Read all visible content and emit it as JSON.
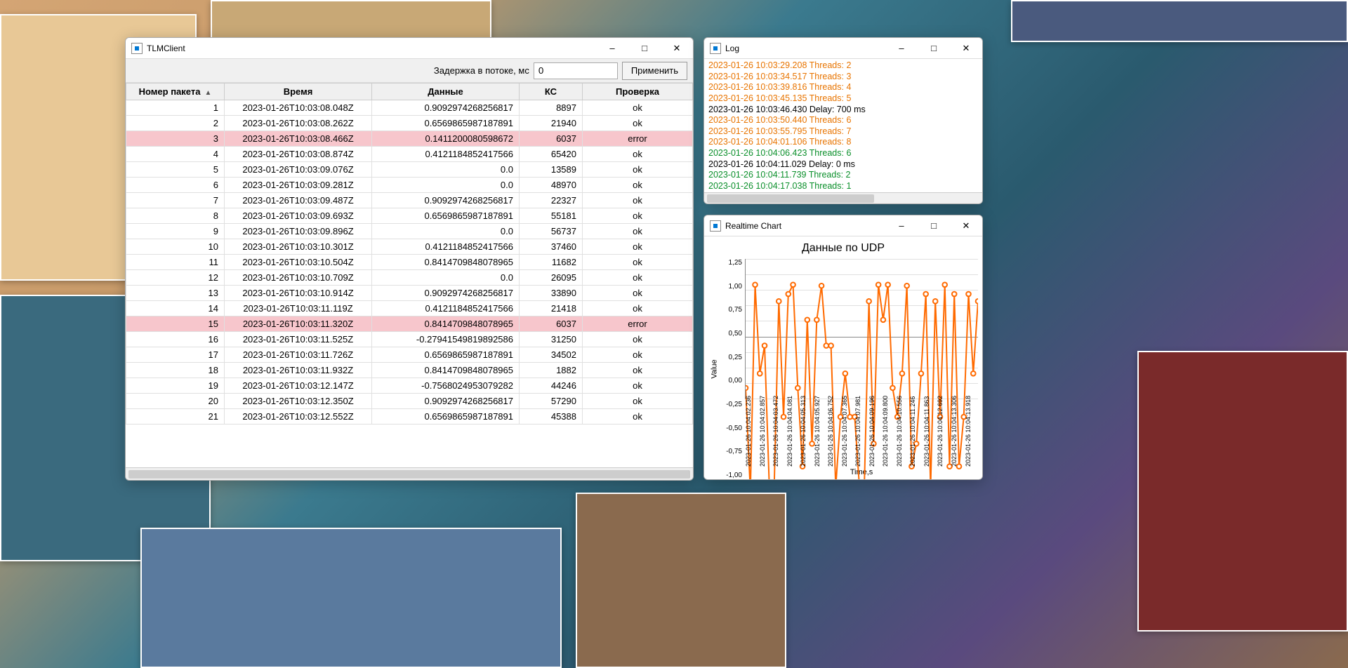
{
  "main_window": {
    "title": "TLMClient",
    "delay_label": "Задержка в потоке, мс",
    "delay_value": "0",
    "apply_label": "Применить",
    "columns": {
      "packet_no": "Номер пакета",
      "time": "Время",
      "data": "Данные",
      "ks": "КС",
      "check": "Проверка"
    },
    "rows": [
      {
        "n": "1",
        "time": "2023-01-26T10:03:08.048Z",
        "data": "0.9092974268256817",
        "ks": "8897",
        "check": "ok",
        "err": false
      },
      {
        "n": "2",
        "time": "2023-01-26T10:03:08.262Z",
        "data": "0.6569865987187891",
        "ks": "21940",
        "check": "ok",
        "err": false
      },
      {
        "n": "3",
        "time": "2023-01-26T10:03:08.466Z",
        "data": "0.1411200080598672",
        "ks": "6037",
        "check": "error",
        "err": true
      },
      {
        "n": "4",
        "time": "2023-01-26T10:03:08.874Z",
        "data": "0.4121184852417566",
        "ks": "65420",
        "check": "ok",
        "err": false
      },
      {
        "n": "5",
        "time": "2023-01-26T10:03:09.076Z",
        "data": "0.0",
        "ks": "13589",
        "check": "ok",
        "err": false
      },
      {
        "n": "6",
        "time": "2023-01-26T10:03:09.281Z",
        "data": "0.0",
        "ks": "48970",
        "check": "ok",
        "err": false
      },
      {
        "n": "7",
        "time": "2023-01-26T10:03:09.487Z",
        "data": "0.9092974268256817",
        "ks": "22327",
        "check": "ok",
        "err": false
      },
      {
        "n": "8",
        "time": "2023-01-26T10:03:09.693Z",
        "data": "0.6569865987187891",
        "ks": "55181",
        "check": "ok",
        "err": false
      },
      {
        "n": "9",
        "time": "2023-01-26T10:03:09.896Z",
        "data": "0.0",
        "ks": "56737",
        "check": "ok",
        "err": false
      },
      {
        "n": "10",
        "time": "2023-01-26T10:03:10.301Z",
        "data": "0.4121184852417566",
        "ks": "37460",
        "check": "ok",
        "err": false
      },
      {
        "n": "11",
        "time": "2023-01-26T10:03:10.504Z",
        "data": "0.8414709848078965",
        "ks": "11682",
        "check": "ok",
        "err": false
      },
      {
        "n": "12",
        "time": "2023-01-26T10:03:10.709Z",
        "data": "0.0",
        "ks": "26095",
        "check": "ok",
        "err": false
      },
      {
        "n": "13",
        "time": "2023-01-26T10:03:10.914Z",
        "data": "0.9092974268256817",
        "ks": "33890",
        "check": "ok",
        "err": false
      },
      {
        "n": "14",
        "time": "2023-01-26T10:03:11.119Z",
        "data": "0.4121184852417566",
        "ks": "21418",
        "check": "ok",
        "err": false
      },
      {
        "n": "15",
        "time": "2023-01-26T10:03:11.320Z",
        "data": "0.8414709848078965",
        "ks": "6037",
        "check": "error",
        "err": true
      },
      {
        "n": "16",
        "time": "2023-01-26T10:03:11.525Z",
        "data": "-0.27941549819892586",
        "ks": "31250",
        "check": "ok",
        "err": false
      },
      {
        "n": "17",
        "time": "2023-01-26T10:03:11.726Z",
        "data": "0.6569865987187891",
        "ks": "34502",
        "check": "ok",
        "err": false
      },
      {
        "n": "18",
        "time": "2023-01-26T10:03:11.932Z",
        "data": "0.8414709848078965",
        "ks": "1882",
        "check": "ok",
        "err": false
      },
      {
        "n": "19",
        "time": "2023-01-26T10:03:12.147Z",
        "data": "-0.7568024953079282",
        "ks": "44246",
        "check": "ok",
        "err": false
      },
      {
        "n": "20",
        "time": "2023-01-26T10:03:12.350Z",
        "data": "0.9092974268256817",
        "ks": "57290",
        "check": "ok",
        "err": false
      },
      {
        "n": "21",
        "time": "2023-01-26T10:03:12.552Z",
        "data": "0.6569865987187891",
        "ks": "45388",
        "check": "ok",
        "err": false
      }
    ]
  },
  "log_window": {
    "title": "Log",
    "lines": [
      {
        "text": "2023-01-26 10:03:29.208  Threads: 2",
        "cls": "orange"
      },
      {
        "text": "2023-01-26 10:03:34.517  Threads: 3",
        "cls": "orange"
      },
      {
        "text": "2023-01-26 10:03:39.816  Threads: 4",
        "cls": "orange"
      },
      {
        "text": "2023-01-26 10:03:45.135  Threads: 5",
        "cls": "orange"
      },
      {
        "text": "2023-01-26 10:03:46.430  Delay: 700 ms",
        "cls": "black"
      },
      {
        "text": "2023-01-26 10:03:50.440  Threads: 6",
        "cls": "orange"
      },
      {
        "text": "2023-01-26 10:03:55.795  Threads: 7",
        "cls": "orange"
      },
      {
        "text": "2023-01-26 10:04:01.106  Threads: 8",
        "cls": "orange"
      },
      {
        "text": "2023-01-26 10:04:06.423  Threads: 6",
        "cls": "green"
      },
      {
        "text": "2023-01-26 10:04:11.029  Delay: 0 ms",
        "cls": "black"
      },
      {
        "text": "2023-01-26 10:04:11.739  Threads: 2",
        "cls": "green"
      },
      {
        "text": "2023-01-26 10:04:17.038  Threads: 1",
        "cls": "green"
      }
    ]
  },
  "chart_window": {
    "title": "Realtime Chart"
  },
  "chart_data": {
    "type": "line",
    "title": "Данные по UDP",
    "xlabel": "Time,s",
    "ylabel": "Value",
    "ylim": [
      -1.0,
      1.25
    ],
    "yticks": [
      "1,25",
      "1,00",
      "0,75",
      "0,50",
      "0,25",
      "0,00",
      "-0,25",
      "-0,50",
      "-0,75",
      "-1,00"
    ],
    "x": [
      "2023-01-26 10:04:02.236",
      "2023-01-26 10:04:02.857",
      "2023-01-26 10:04:03.472",
      "2023-01-26 10:04:04.081",
      "2023-01-26 10:04:05.313",
      "2023-01-26 10:04:05.927",
      "2023-01-26 10:04:06.752",
      "2023-01-26 10:04:07.365",
      "2023-01-26 10:04:07.981",
      "2023-01-26 10:04:09.196",
      "2023-01-26 10:04:09.800",
      "2023-01-26 10:04:10.556",
      "2023-01-26 10:04:11.246",
      "2023-01-26 10:04:11.863",
      "2023-01-26 10:04:12.692",
      "2023-01-26 10:04:13.306",
      "2023-01-26 10:04:13.918"
    ],
    "values": [
      0.0,
      -1.0,
      1.0,
      0.14,
      0.41,
      -0.96,
      -1.0,
      0.84,
      -0.28,
      0.91,
      1.0,
      0.0,
      -0.76,
      0.66,
      -0.54,
      0.66,
      0.99,
      0.41,
      0.41,
      -0.96,
      -0.28,
      0.14,
      -0.28,
      -0.28,
      -0.96,
      -1.0,
      0.84,
      -0.54,
      1.0,
      0.66,
      1.0,
      0.0,
      -0.28,
      0.14,
      0.99,
      -0.76,
      -0.54,
      0.14,
      0.91,
      -0.96,
      0.84,
      -0.28,
      1.0,
      -0.76,
      0.91,
      -0.76,
      -0.28,
      0.91,
      0.14,
      0.84
    ]
  }
}
